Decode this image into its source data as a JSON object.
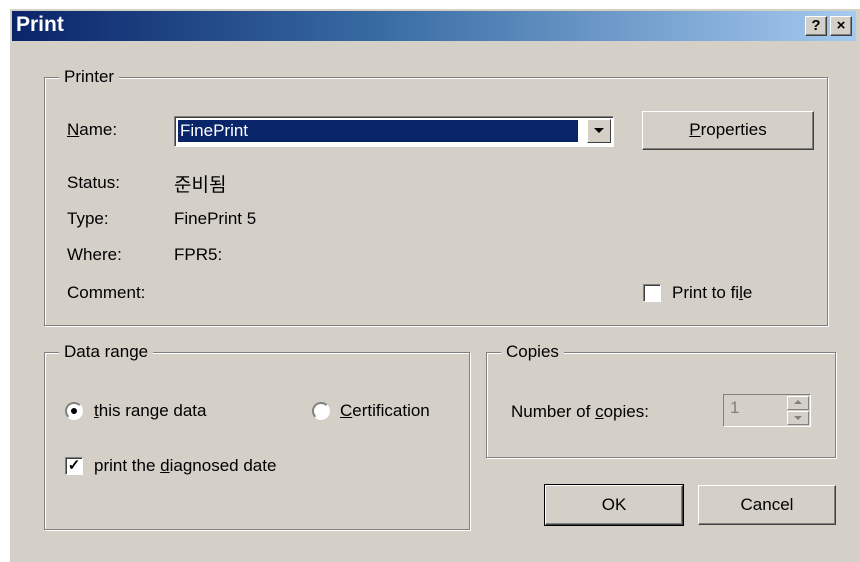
{
  "window": {
    "title": "Print",
    "help_btn": "?",
    "close_btn": "×"
  },
  "printer": {
    "legend": "Printer",
    "name_label_u": "N",
    "name_label_rest": "ame:",
    "name_value": "FinePrint",
    "properties_u": "P",
    "properties_rest": "roperties",
    "status_label": "Status:",
    "status_value": "준비됨",
    "type_label": "Type:",
    "type_value": "FinePrint 5",
    "where_label": "Where:",
    "where_value": "FPR5:",
    "comment_label": "Comment:",
    "print_to_file_pre": "Print to fi",
    "print_to_file_u": "l",
    "print_to_file_post": "e",
    "print_to_file_checked": false
  },
  "data_range": {
    "legend": "Data range",
    "radio1_u": "t",
    "radio1_rest": "his range data",
    "radio1_selected": true,
    "radio2_u": "C",
    "radio2_rest": "ertification",
    "radio2_selected": false,
    "check_pre": "print the ",
    "check_u": "d",
    "check_post": "iagnosed date",
    "check_checked": true
  },
  "copies": {
    "legend": "Copies",
    "label_pre": "Number of ",
    "label_u": "c",
    "label_post": "opies:",
    "value": "1"
  },
  "buttons": {
    "ok": "OK",
    "cancel": "Cancel"
  }
}
